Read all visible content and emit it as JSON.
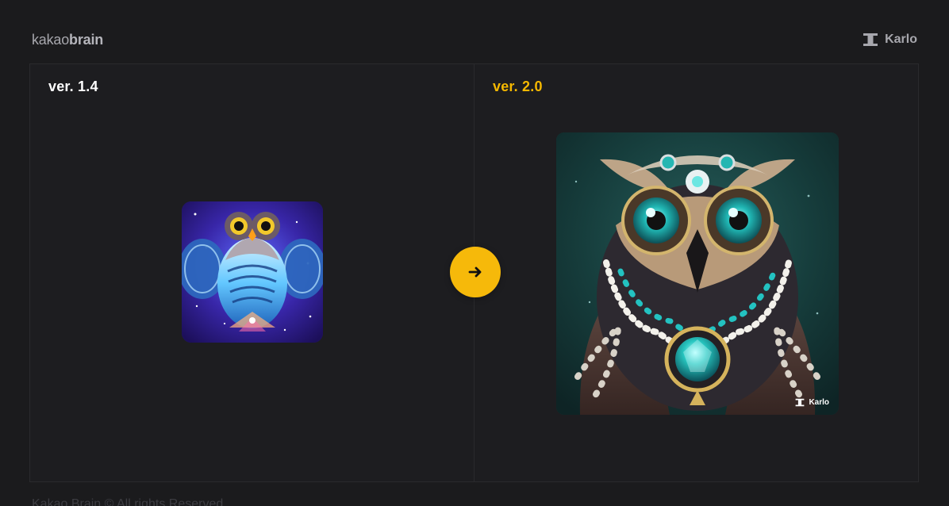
{
  "brand": {
    "name_light": "kakao",
    "name_bold": "brain"
  },
  "product": {
    "name": "Karlo",
    "icon": "karlo-logo-icon"
  },
  "comparison": {
    "old_version_label": "ver. 1.4",
    "new_version_label": "ver. 2.0",
    "arrow_icon": "arrow-right-icon",
    "watermark": "Karlo"
  },
  "footer": {
    "copyright": "Kakao Brain © All rights Reserved"
  },
  "colors": {
    "background": "#1b1b1d",
    "accent": "#f6b90a",
    "new_version_label": "#f5b800"
  }
}
